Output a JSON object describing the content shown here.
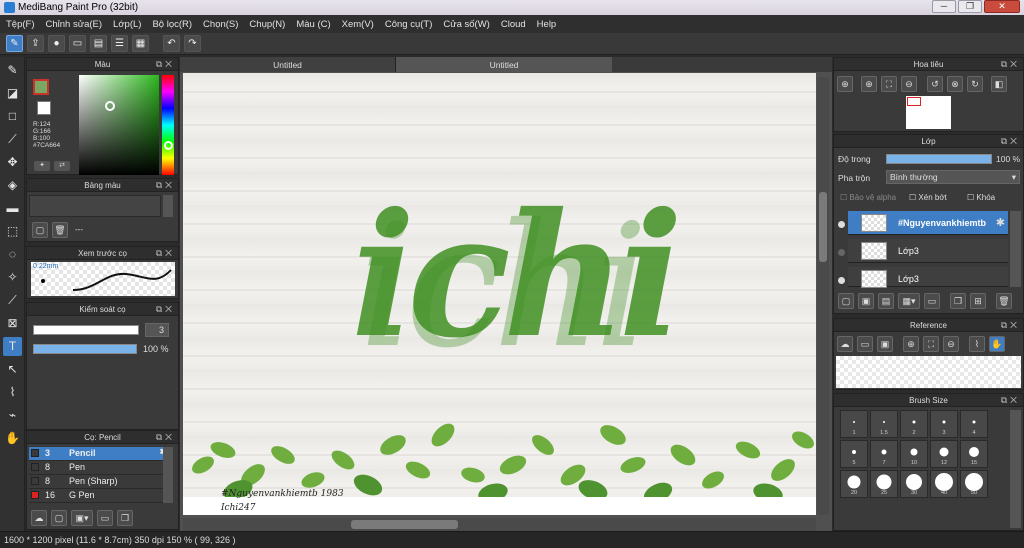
{
  "window": {
    "title": "MediBang Paint Pro (32bit)",
    "minimize": "─",
    "maximize": "❐",
    "close": "✕"
  },
  "menu": [
    "Tệp(F)",
    "Chỉnh sửa(E)",
    "Lớp(L)",
    "Bộ lọc(R)",
    "Chọn(S)",
    "Chụp(N)",
    "Màu (C)",
    "Xem(V)",
    "Công cụ(T)",
    "Cửa số(W)",
    "Cloud",
    "Help"
  ],
  "toolbar": {
    "buttons": [
      "brush-mode-icon",
      "share-icon",
      "comment-icon",
      "chat-icon",
      "page-icon",
      "list-icon",
      "grid-icon"
    ],
    "undo": "↶",
    "redo": "↷"
  },
  "tools": [
    "brush-icon",
    "eraser-icon",
    "rectangle-icon",
    "pen-icon",
    "move-icon",
    "fill-icon",
    "gradient-icon",
    "select-rect-icon",
    "lasso-icon",
    "magic-wand-icon",
    "select-pen-icon",
    "select-eraser-icon",
    "text-icon",
    "operation-icon",
    "eyedropper-icon",
    "dropper-icon",
    "hand-icon"
  ],
  "color_panel": {
    "title": "Màu",
    "main_color": "#7CA664",
    "rgb": {
      "r": "R:124",
      "g": "G:166",
      "b": "B:100",
      "hex": "#7CA664"
    }
  },
  "palette_panel": {
    "title": "Bảng màu",
    "dash": "---"
  },
  "preview_panel": {
    "title": "Xem trước cọ",
    "size": "0.22mm"
  },
  "control_panel": {
    "title": "Kiểm soát cọ",
    "size_value": "3",
    "opacity_value": "100 %",
    "size_fraction": 1.0,
    "opacity_fraction": 1.0
  },
  "brush_panel": {
    "title": "Cọ: Pencil",
    "items": [
      {
        "size": "3",
        "name": "Pencil",
        "selected": true,
        "color": "#3a3a3a"
      },
      {
        "size": "8",
        "name": "Pen",
        "selected": false,
        "color": "#3a3a3a"
      },
      {
        "size": "8",
        "name": "Pen (Sharp)",
        "selected": false,
        "color": "#3a3a3a"
      },
      {
        "size": "16",
        "name": "G Pen",
        "selected": false,
        "color": "#d22"
      }
    ]
  },
  "document": {
    "tabs": [
      "Untitled",
      "Untitled"
    ],
    "lettering": "ichi",
    "credit_line1": "#Nguyenvankhiemtb 1983",
    "credit_line2": "Ichi247",
    "lettering_color": "#3f8f22"
  },
  "navigator_panel": {
    "title": "Hoa tiêu"
  },
  "layer_panel": {
    "title": "Lớp",
    "opacity_label": "Độ trong",
    "opacity_value": "100 %",
    "opacity_fraction": 1.0,
    "blend_label": "Pha trộn",
    "blend_value": "Bình thường",
    "protect_alpha": "Bảo vệ alpha",
    "clipping": "Xén bớt",
    "lock": "Khóa",
    "layers": [
      {
        "name": "#Nguyenvankhiemtb",
        "selected": true
      },
      {
        "name": "Lớp3",
        "selected": false
      },
      {
        "name": "Lớp3",
        "selected": false
      }
    ]
  },
  "reference_panel": {
    "title": "Reference"
  },
  "brush_size_panel": {
    "title": "Brush Size",
    "sizes": [
      "1",
      "1.5",
      "2",
      "3",
      "4",
      "5",
      "7",
      "10",
      "12",
      "15",
      "20",
      "25",
      "30",
      "40",
      "50"
    ]
  },
  "status": {
    "text": "1600 * 1200 pixel   (11.6 * 8.7cm)   350 dpi   150 %   ( 99, 326 )"
  }
}
